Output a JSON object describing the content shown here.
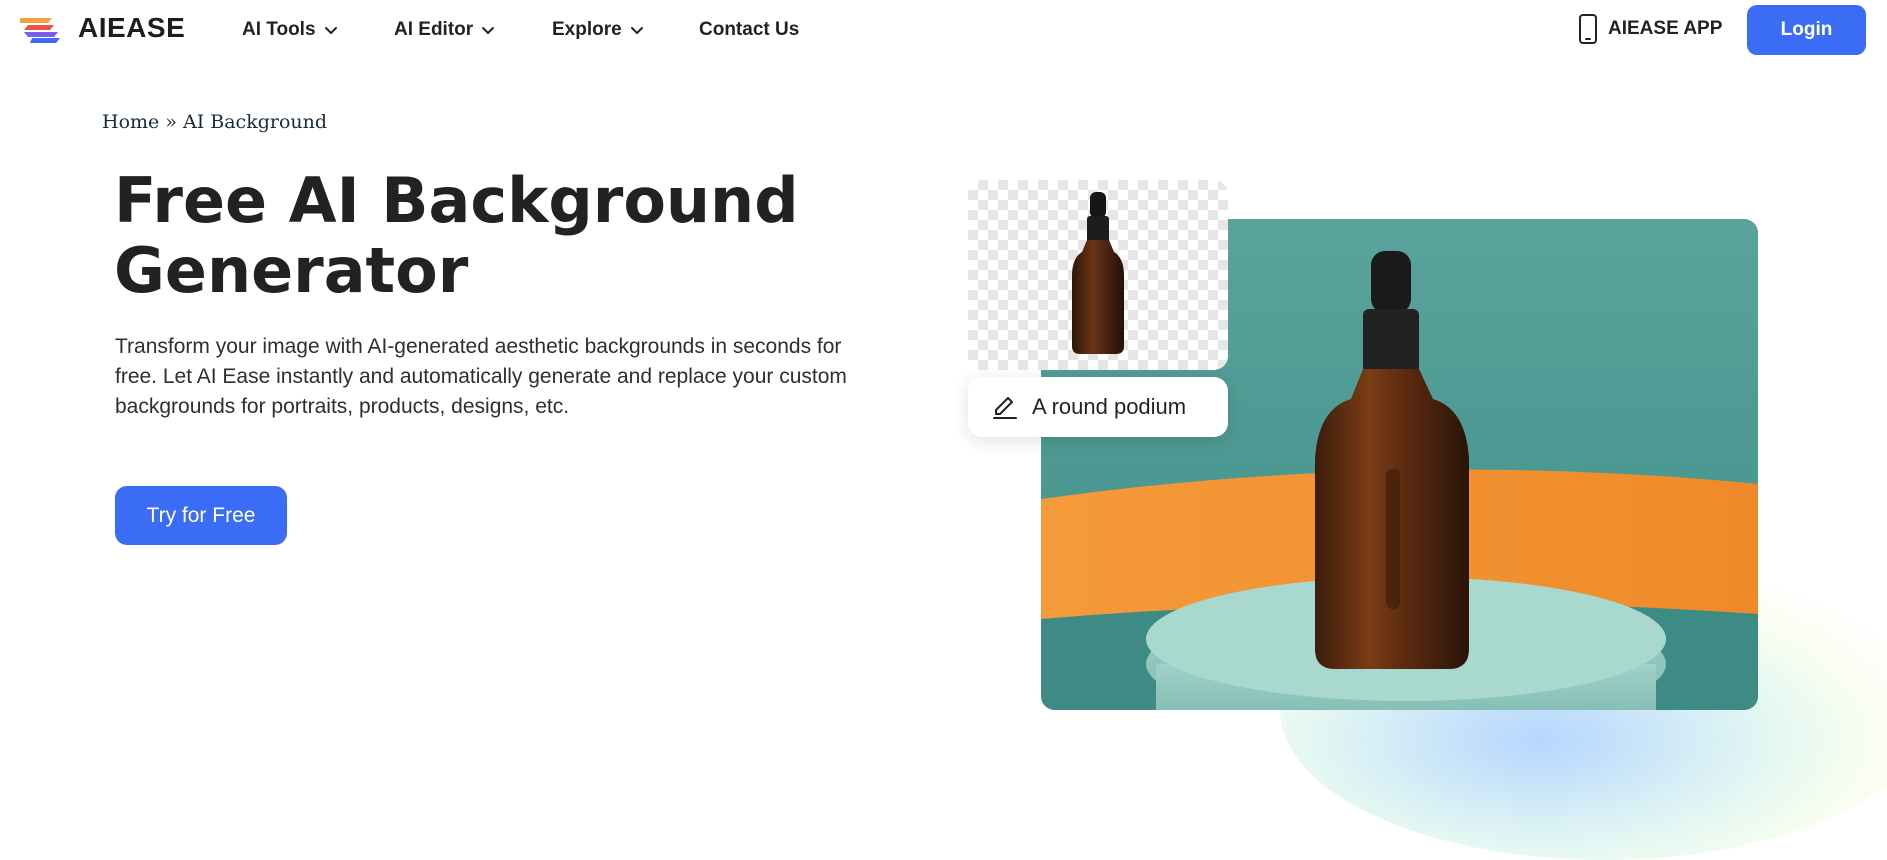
{
  "header": {
    "brand": "AIEASE",
    "nav": [
      {
        "label": "AI Tools",
        "has_dropdown": true
      },
      {
        "label": "AI Editor",
        "has_dropdown": true
      },
      {
        "label": "Explore",
        "has_dropdown": true
      },
      {
        "label": "Contact Us",
        "has_dropdown": false
      }
    ],
    "app_label": "AIEASE APP",
    "login_label": "Login"
  },
  "breadcrumb": {
    "home": "Home",
    "separator": " » ",
    "current": "AI Background"
  },
  "hero": {
    "title_line1": "Free AI Background",
    "title_line2": "Generator",
    "description_line1": "Transform your image with AI-generated aesthetic backgrounds in seconds for",
    "description_line2": "free. Let AI Ease instantly and automatically generate and replace your custom",
    "description_line3": "backgrounds for portraits, products, designs, etc.",
    "cta_label": "Try for Free",
    "prompt_text": "A round podium"
  },
  "colors": {
    "accent": "#3b6cf5",
    "teal_bg": "#4e9b94",
    "orange_bg": "#f08a2c",
    "podium": "#8fc8bf"
  },
  "icons": {
    "logo": "aiease-logo-icon",
    "dropdown": "chevron-down-icon",
    "app": "phone-icon",
    "prompt": "pencil-icon"
  }
}
